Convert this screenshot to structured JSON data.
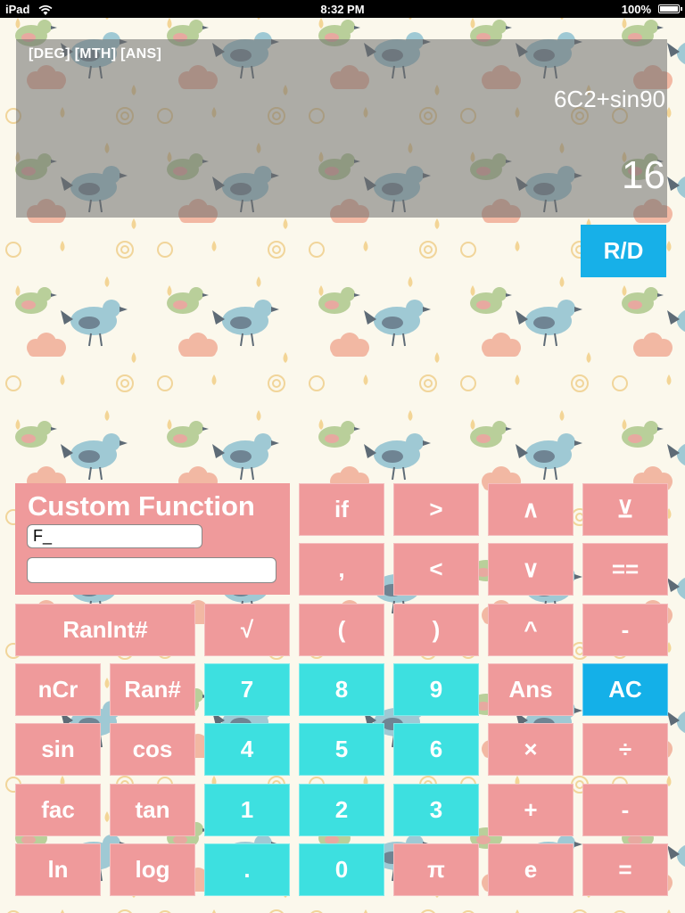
{
  "status_bar": {
    "device": "iPad",
    "time": "8:32 PM",
    "battery": "100%",
    "battery_level": 1.0
  },
  "display": {
    "mode": "[DEG] [MTH] [ANS]",
    "expression": "6C2+sin90",
    "result": "16"
  },
  "rd_button": {
    "label": "R/D"
  },
  "custom_function": {
    "title": "Custom Function",
    "name_value": "F_",
    "body_value": ""
  },
  "keys": {
    "if": "if",
    "gt": ">",
    "and": "∧",
    "xor": "⊻",
    "comma": ",",
    "lt": "<",
    "or": "∨",
    "eq": "==",
    "ranint": "RanInt#",
    "sqrt": "√",
    "lparen": "(",
    "rparen": ")",
    "pow": "^",
    "minus_top": "-",
    "ncr": "nCr",
    "ran": "Ran#",
    "n7": "7",
    "n8": "8",
    "n9": "9",
    "ans": "Ans",
    "ac": "AC",
    "sin": "sin",
    "cos": "cos",
    "n4": "4",
    "n5": "5",
    "n6": "6",
    "mul": "×",
    "div": "÷",
    "fac": "fac",
    "tan": "tan",
    "n1": "1",
    "n2": "2",
    "n3": "3",
    "plus": "+",
    "minus": "-",
    "ln": "ln",
    "log": "log",
    "dot": ".",
    "n0": "0",
    "pi": "π",
    "e": "e",
    "equals": "="
  },
  "colors": {
    "key_function": "#ef9a9b",
    "key_digit": "#3de0e0",
    "key_accent": "#14b0e8",
    "display_overlay": "#6e6e6e"
  },
  "background_pattern": "birds-and-clouds-pattern"
}
